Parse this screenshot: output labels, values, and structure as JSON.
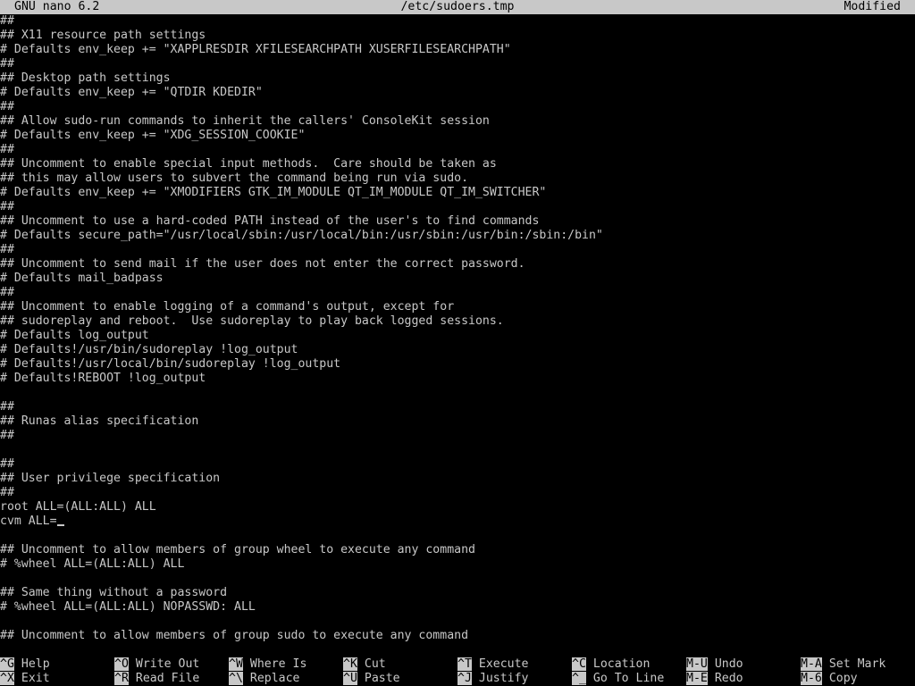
{
  "titlebar": {
    "app": "GNU nano 6.2",
    "file": "/etc/sudoers.tmp",
    "status": "Modified"
  },
  "lines": [
    "##",
    "## X11 resource path settings",
    "# Defaults env_keep += \"XAPPLRESDIR XFILESEARCHPATH XUSERFILESEARCHPATH\"",
    "##",
    "## Desktop path settings",
    "# Defaults env_keep += \"QTDIR KDEDIR\"",
    "##",
    "## Allow sudo-run commands to inherit the callers' ConsoleKit session",
    "# Defaults env_keep += \"XDG_SESSION_COOKIE\"",
    "##",
    "## Uncomment to enable special input methods.  Care should be taken as",
    "## this may allow users to subvert the command being run via sudo.",
    "# Defaults env_keep += \"XMODIFIERS GTK_IM_MODULE QT_IM_MODULE QT_IM_SWITCHER\"",
    "##",
    "## Uncomment to use a hard-coded PATH instead of the user's to find commands",
    "# Defaults secure_path=\"/usr/local/sbin:/usr/local/bin:/usr/sbin:/usr/bin:/sbin:/bin\"",
    "##",
    "## Uncomment to send mail if the user does not enter the correct password.",
    "# Defaults mail_badpass",
    "##",
    "## Uncomment to enable logging of a command's output, except for",
    "## sudoreplay and reboot.  Use sudoreplay to play back logged sessions.",
    "# Defaults log_output",
    "# Defaults!/usr/bin/sudoreplay !log_output",
    "# Defaults!/usr/local/bin/sudoreplay !log_output",
    "# Defaults!REBOOT !log_output",
    "",
    "##",
    "## Runas alias specification",
    "##",
    "",
    "##",
    "## User privilege specification",
    "##",
    "root ALL=(ALL:ALL) ALL",
    "cvm ALL=",
    "",
    "## Uncomment to allow members of group wheel to execute any command",
    "# %wheel ALL=(ALL:ALL) ALL",
    "",
    "## Same thing without a password",
    "# %wheel ALL=(ALL:ALL) NOPASSWD: ALL",
    "",
    "## Uncomment to allow members of group sudo to execute any command"
  ],
  "shortcuts": {
    "row1": [
      {
        "key": "^G",
        "label": "Help"
      },
      {
        "key": "^O",
        "label": "Write Out"
      },
      {
        "key": "^W",
        "label": "Where Is"
      },
      {
        "key": "^K",
        "label": "Cut"
      },
      {
        "key": "^T",
        "label": "Execute"
      },
      {
        "key": "^C",
        "label": "Location"
      },
      {
        "key": "M-U",
        "label": "Undo"
      },
      {
        "key": "M-A",
        "label": "Set Mark"
      }
    ],
    "row2": [
      {
        "key": "^X",
        "label": "Exit"
      },
      {
        "key": "^R",
        "label": "Read File"
      },
      {
        "key": "^\\",
        "label": "Replace"
      },
      {
        "key": "^U",
        "label": "Paste"
      },
      {
        "key": "^J",
        "label": "Justify"
      },
      {
        "key": "^_",
        "label": "Go To Line"
      },
      {
        "key": "M-E",
        "label": "Redo"
      },
      {
        "key": "M-6",
        "label": "Copy"
      }
    ]
  },
  "colors": {
    "background": "#000000",
    "text": "#c8c8c8",
    "inverse_bg": "#c8c8c8",
    "inverse_fg": "#000000"
  }
}
